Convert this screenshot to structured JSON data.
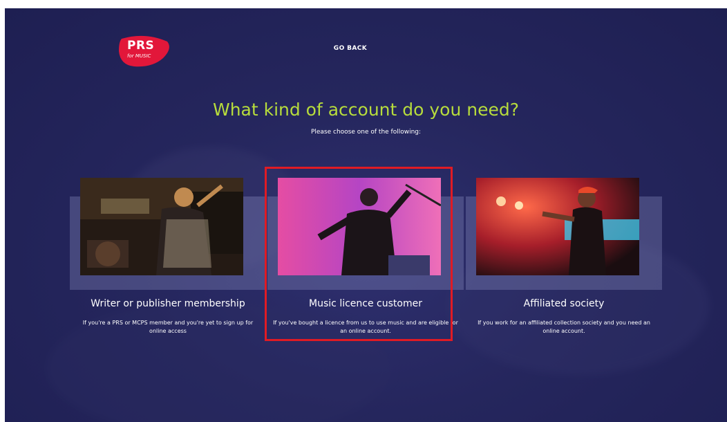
{
  "header": {
    "logo_main": "PRS",
    "logo_sub": "for MUSIC",
    "go_back_label": "GO BACK"
  },
  "main": {
    "heading": "What kind of account do you need?",
    "subheading": "Please choose one of the following:"
  },
  "cards": [
    {
      "title": "Writer or publisher membership",
      "description": "If you're a PRS or MCPS member and you're yet to sign up for online access"
    },
    {
      "title": "Music licence customer",
      "description": "If you've bought a licence from us to use music and are eligible for an online account."
    },
    {
      "title": "Affiliated society",
      "description": "If you work for an affiliated collection society and you need an online account."
    }
  ],
  "colors": {
    "background": "#25265d",
    "heading": "#b7dc3c",
    "brand_red": "#e2173a",
    "highlight_border": "#e01b24"
  },
  "icons": {
    "logo": "prs-for-music-logo"
  }
}
